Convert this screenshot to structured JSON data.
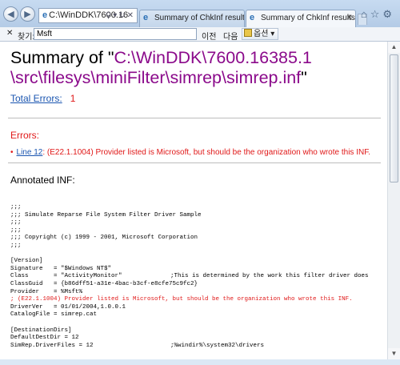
{
  "browser": {
    "address": "C:\\WinDDK\\7600.16",
    "tabs": [
      {
        "label": "Summary of ChkInf results for..."
      },
      {
        "label": "Summary of ChkInf results..."
      }
    ]
  },
  "findbar": {
    "label": "찾기:",
    "query": "Msft",
    "prev_label": "이전",
    "next_label": "다음",
    "options_label": "옵션"
  },
  "page": {
    "title_prefix": "Summary of \"",
    "title_path": "C:\\WinDDK\\7600.16385.1\n\\src\\filesys\\miniFilter\\simrep\\simrep.inf",
    "title_suffix": "\"",
    "total_errors_label": "Total Errors:",
    "total_errors_count": "1",
    "errors_heading": "Errors:",
    "error_link": "Line 12",
    "error_text": ": (E22.1.1004) Provider listed is Microsoft, but should be the organization who wrote this INF.",
    "annotated_heading": "Annotated INF:",
    "inf_lines": [
      {
        "text": ";;;"
      },
      {
        "text": ";;; Simulate Reparse File System Filter Driver Sample"
      },
      {
        "text": ";;;"
      },
      {
        "text": ";;;"
      },
      {
        "text": ";;; Copyright (c) 1999 - 2001, Microsoft Corporation"
      },
      {
        "text": ";;;"
      },
      {
        "text": ""
      },
      {
        "text": "[Version]"
      },
      {
        "text": "Signature   = \"$Windows NT$\""
      },
      {
        "text": "Class       = \"ActivityMonitor\"",
        "comment": ";This is determined by the work this filter driver does"
      },
      {
        "text": "ClassGuid   = {b86dff51-a31e-4bac-b3cf-e8cfe75c9fc2}"
      },
      {
        "text": "Provider    = %Msft%"
      },
      {
        "text": "; (E22.1.1004) Provider listed is Microsoft, but should be the organization who wrote this INF.",
        "error": true
      },
      {
        "text": "DriverVer   = 01/01/2004,1.0.0.1"
      },
      {
        "text": "CatalogFile = simrep.cat"
      },
      {
        "text": ""
      },
      {
        "text": "[DestinationDirs]"
      },
      {
        "text": "DefaultDestDir = 12"
      },
      {
        "text": "SimRep.DriverFiles = 12",
        "comment": ";%windir%\\system32\\drivers"
      }
    ]
  },
  "colors": {
    "link": "#1a55b0",
    "error": "#e01818",
    "path": "#8b0a8b"
  }
}
